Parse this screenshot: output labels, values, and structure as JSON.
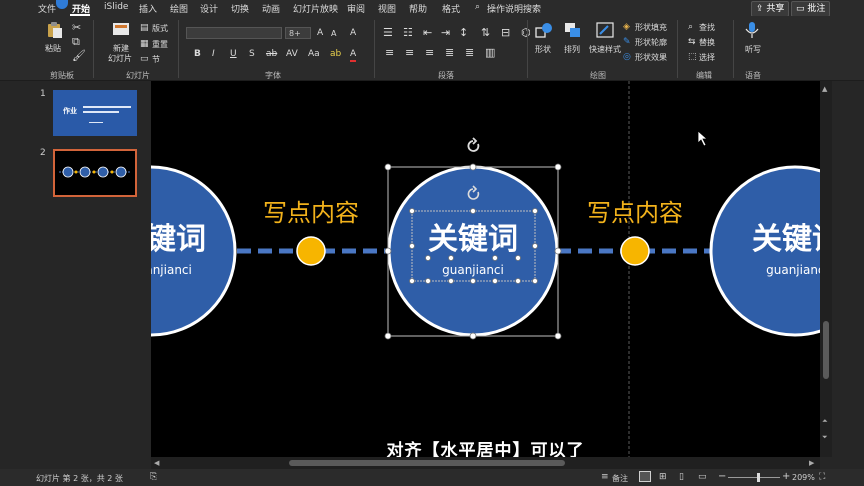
{
  "menu": {
    "file": "文件",
    "home": "开始",
    "islide": "iSlide",
    "insert": "插入",
    "draw": "绘图",
    "design": "设计",
    "transitions": "切换",
    "animations": "动画",
    "slideshow": "幻灯片放映",
    "review": "审阅",
    "view": "视图",
    "help": "帮助",
    "format": "格式",
    "tell_me": "操作说明搜索",
    "share": "共享",
    "comments": "批注"
  },
  "ribbon": {
    "clipboard": {
      "paste": "粘贴",
      "label": "剪贴板"
    },
    "slides": {
      "new_slide_l1": "新建",
      "new_slide_l2": "幻灯片",
      "layout": "版式",
      "reset": "重置",
      "section": "节",
      "label": "幻灯片"
    },
    "font": {
      "size": "8+",
      "label": "字体"
    },
    "paragraph": {
      "label": "段落"
    },
    "drawing": {
      "shape": "形状",
      "arrange": "排列",
      "quick_styles": "快速样式",
      "shape_fill": "形状填充",
      "shape_outline": "形状轮廓",
      "shape_effects": "形状效果",
      "label": "绘图"
    },
    "editing": {
      "find": "查找",
      "replace": "替换",
      "select": "选择",
      "label": "编辑"
    },
    "voice": {
      "dictate": "听写",
      "label": "语音"
    }
  },
  "thumbnails": [
    {
      "number": "1",
      "title": "作业"
    },
    {
      "number": "2"
    }
  ],
  "slide": {
    "node_left": {
      "keyword": "关键词",
      "pinyin": "guanjianci"
    },
    "text_left": "写点内容",
    "node_center": {
      "keyword": "关键词",
      "pinyin": "guanjianci"
    },
    "text_right": "写点内容",
    "node_right": {
      "keyword": "关键词",
      "pinyin": "guanjianci"
    },
    "caption": "对齐【水平居中】可以了"
  },
  "status": {
    "slide_info": "幻灯片 第 2 张，共 2 张",
    "notes": "备注",
    "zoom": "209%"
  },
  "colors": {
    "circle_fill": "#2f5ea8",
    "circle_stroke": "#ffffff",
    "dot_fill": "#f7b500",
    "accent_text": "#f2b21b",
    "dash": "#4a77c4"
  }
}
